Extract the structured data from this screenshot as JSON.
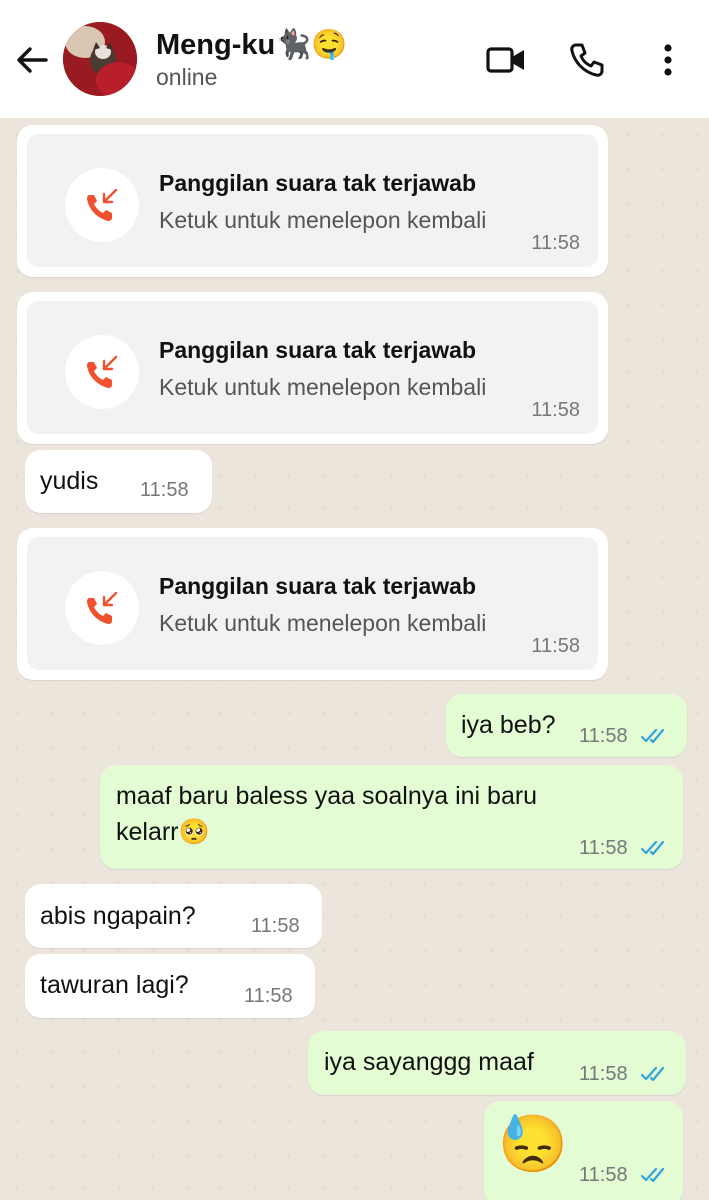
{
  "header": {
    "contact_name": "Meng-ku🐈‍⬛🤤",
    "status": "online"
  },
  "colors": {
    "incoming_bubble": "#ffffff",
    "outgoing_bubble": "#e3fcd4",
    "missed_call_icon": "#f0522f",
    "read_ticks": "#34a3dc",
    "chat_background": "#ece5dc"
  },
  "icons": {
    "back": "back-arrow-icon",
    "video": "video-call-icon",
    "voice": "phone-icon",
    "menu": "more-vert-icon",
    "missed_call": "missed-call-icon",
    "read": "double-check-icon"
  },
  "messages": [
    {
      "kind": "missed_call",
      "title": "Panggilan suara tak terjawab",
      "subtitle": "Ketuk untuk menelepon kembali",
      "time": "11:58"
    },
    {
      "kind": "missed_call",
      "title": "Panggilan suara tak terjawab",
      "subtitle": "Ketuk untuk menelepon kembali",
      "time": "11:58"
    },
    {
      "kind": "incoming",
      "text": "yudis",
      "time": "11:58"
    },
    {
      "kind": "missed_call",
      "title": "Panggilan suara tak terjawab",
      "subtitle": "Ketuk untuk menelepon kembali",
      "time": "11:58"
    },
    {
      "kind": "outgoing",
      "text": "iya beb?",
      "time": "11:58",
      "read": true
    },
    {
      "kind": "outgoing",
      "text_line1": "maaf baru baless yaa soalnya ini baru",
      "text_line2": "kelarr🥺",
      "time": "11:58",
      "read": true
    },
    {
      "kind": "incoming",
      "text": "abis ngapain?",
      "time": "11:58"
    },
    {
      "kind": "incoming",
      "text": "tawuran lagi?",
      "time": "11:58"
    },
    {
      "kind": "outgoing",
      "text": "iya sayanggg maaf",
      "time": "11:58",
      "read": true
    },
    {
      "kind": "outgoing",
      "text": "😓",
      "time": "11:58",
      "read": true
    }
  ]
}
